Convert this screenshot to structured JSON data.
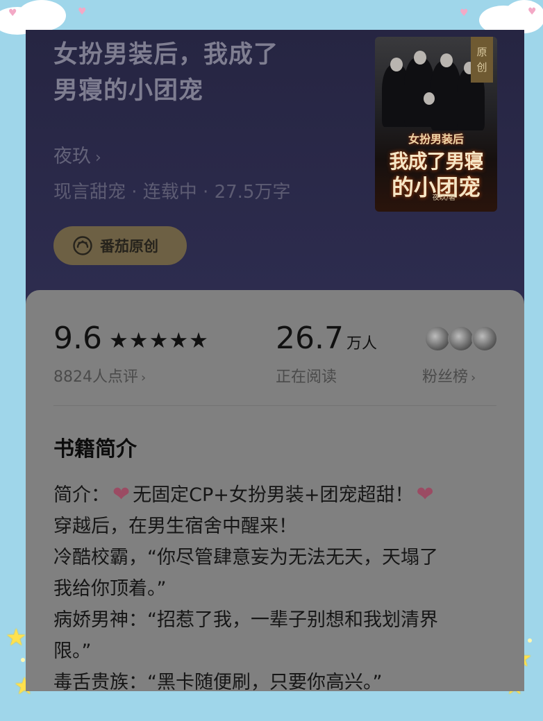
{
  "book": {
    "title_line1": "女扮男装后，我成了",
    "title_line2": "男寝的小团宠",
    "author": "夜玖",
    "author_chevron": "›",
    "meta": "现言甜宠 · 连载中 · 27.5万字",
    "tag_label": "番茄原创",
    "tag_icon": "tomato-original-icon"
  },
  "cover": {
    "badge_line1": "原",
    "badge_line2": "创",
    "subtitle": "女扮男装后",
    "title_line1": "我成了男寝",
    "title_line2": "的小团宠",
    "author": "夜玖/著"
  },
  "stats": {
    "rating": "9.6",
    "stars": "★★★★★",
    "star_count": 5,
    "reviews": "8824人点评",
    "readers_num": "26.7",
    "readers_unit": "万人",
    "readers_label": "正在阅读",
    "fans_label": "粉丝榜",
    "chevron": "›"
  },
  "intro": {
    "section_title": "书籍简介",
    "line1_prefix": "简介：",
    "line1_body": "无固定CP+女扮男装+团宠超甜！",
    "heart": "❤",
    "line2": "穿越后，在男生宿舍中醒来！",
    "line3": "冷酷校霸，“你尽管肆意妄为无法无天，天塌了",
    "line4": "我给你顶着。”",
    "line5": "病娇男神：“招惹了我，一辈子别想和我划清界",
    "line6": "限。”",
    "line7": "毒舌贵族：“黑卡随便刷，只要你高兴。”"
  },
  "colors": {
    "frame": "#9fd6ea",
    "header_bg": "#262542",
    "panel_bg": "#808080",
    "tag_bg": "#6d6044",
    "heart": "#9b4b63"
  }
}
